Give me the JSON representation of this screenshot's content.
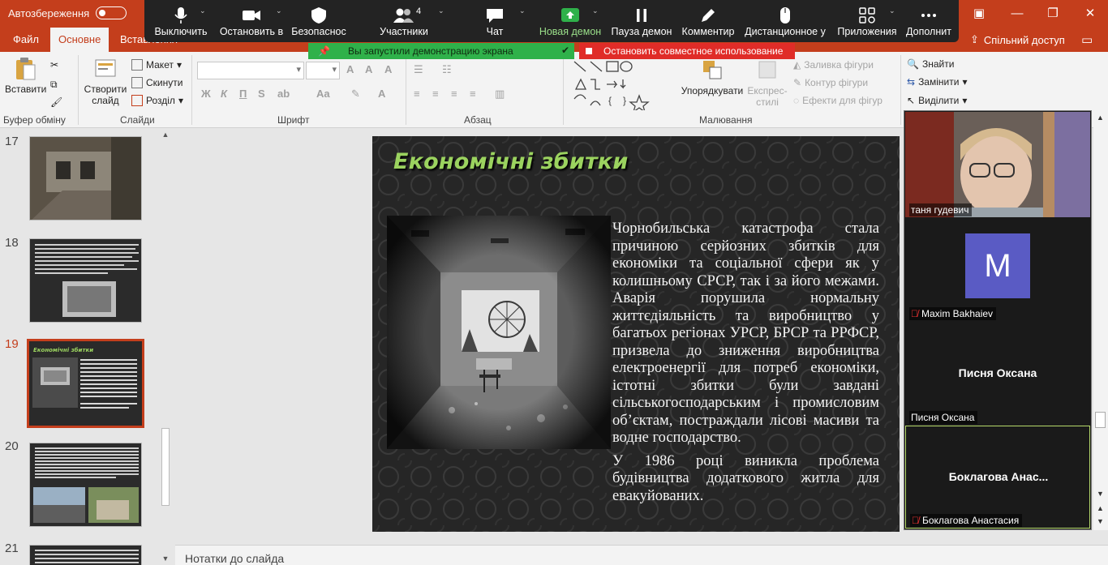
{
  "titlebar": {
    "autosave_label": "Автозбереження",
    "autosave_state": "off"
  },
  "tabs": {
    "file": "Файл",
    "home": "Основне",
    "insert": "Вставлення",
    "share": "Спільний доступ"
  },
  "ribbon": {
    "clipboard": {
      "label": "Буфер обміну",
      "paste": "Вставити"
    },
    "slides": {
      "label": "Слайди",
      "new_slide": "Створити слайд",
      "layout": "Макет",
      "reset": "Скинути",
      "section": "Розділ"
    },
    "font": {
      "label": "Шрифт",
      "bold": "Ж",
      "italic": "К",
      "underline": "П",
      "strike": "S"
    },
    "paragraph": {
      "label": "Абзац"
    },
    "drawing": {
      "label": "Малювання",
      "arrange": "Упорядкувати",
      "quick_styles": "Експрес-стилі",
      "shape_fill": "Заливка фігури",
      "shape_outline": "Контур фігури",
      "shape_effects": "Ефекти для фігур"
    },
    "editing": {
      "find": "Знайти",
      "replace": "Замінити",
      "select": "Виділити"
    }
  },
  "zoom": {
    "mute": "Выключить",
    "video": "Остановить в",
    "security": "Безопаснос",
    "participants": "Участники",
    "participants_count": "4",
    "chat": "Чат",
    "new_share": "Новая демон",
    "pause_share": "Пауза демон",
    "annotate": "Комментир",
    "remote_control": "Дистанционное у",
    "apps": "Приложения",
    "more": "Дополнит",
    "banner": "Вы запустили демонстрацию экрана",
    "stop_share": "Остановить совместное использование"
  },
  "thumbnails": [
    {
      "num": "17",
      "theme": "photo"
    },
    {
      "num": "18",
      "theme": "text-photo"
    },
    {
      "num": "19",
      "theme": "current",
      "mini_title": "Економічні збитки"
    },
    {
      "num": "20",
      "theme": "text-photo"
    },
    {
      "num": "21",
      "theme": "text"
    }
  ],
  "slide": {
    "title": "Економічні збитки",
    "paragraph1": "Чорнобильська катастрофа стала причиною серйозних збитків для економіки та соціальної сфери як у колишньому СРСР, так і за його межами. Аварія порушила нормальну життєдіяльність та виробництво у багатьох регіонах УРСР, БРСР та РРФСР, призвела до зниження виробництва електроенергії для потреб економіки, істотні збитки були завдані сільськогосподарським і промисловим об’єктам, постраждали лісові масиви та водне господарство.",
    "paragraph2": "У 1986 році виникла проблема будівництва додаткового житла для евакуйованих."
  },
  "notes": {
    "placeholder": "Нотатки до слайда"
  },
  "participants": [
    {
      "name": "таня гудевич",
      "type": "video",
      "muted": false
    },
    {
      "name": "Maxim Bakhaiev",
      "type": "avatar",
      "initial": "M",
      "muted": true
    },
    {
      "name": "Писня Оксана",
      "type": "name",
      "display": "Писня Оксана",
      "muted": false
    },
    {
      "name": "Боклагова Анастасия",
      "type": "name",
      "display": "Боклагова  Анас...",
      "muted": true,
      "active": true
    }
  ],
  "colors": {
    "accent": "#c43e1c",
    "slide_title": "#9bd35f",
    "zoom_green": "#2fb14a",
    "zoom_red": "#e02c28",
    "avatar": "#5a5bc4"
  }
}
